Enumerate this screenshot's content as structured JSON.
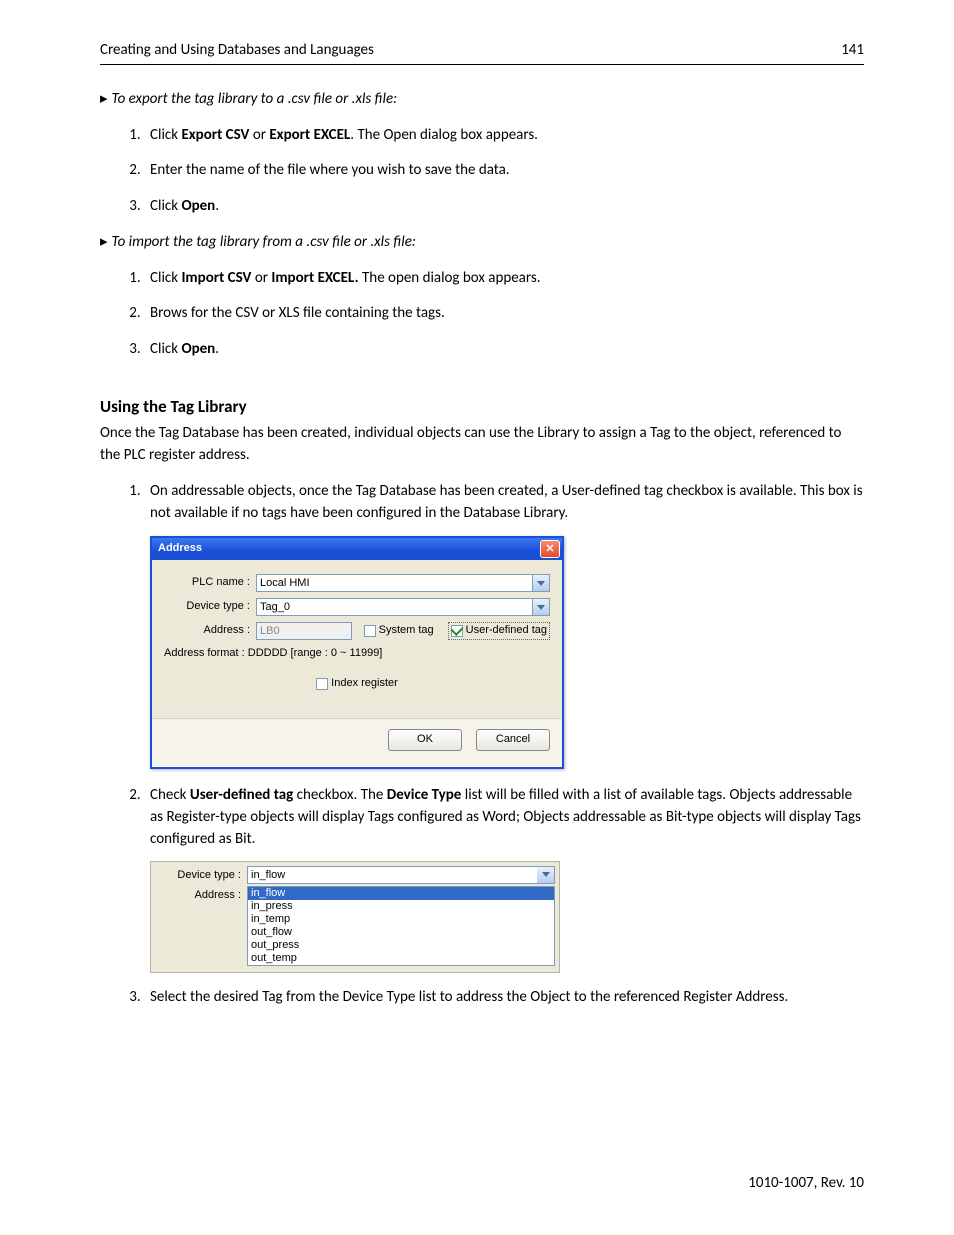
{
  "header": {
    "title": "Creating and Using Databases and Languages",
    "page": "141"
  },
  "export": {
    "prompt": "To export the tag library to a .csv file or .xls file:",
    "steps": {
      "s1_pre": "Click ",
      "s1_b1": "Export CSV",
      "s1_mid": " or ",
      "s1_b2": "Export EXCEL",
      "s1_post": ". The Open dialog box appears.",
      "s2": "Enter the name of the file where you wish to save the data.",
      "s3_pre": "Click ",
      "s3_b": "Open",
      "s3_post": "."
    }
  },
  "import": {
    "prompt": "To import the tag library from a .csv file or .xls file:",
    "steps": {
      "s1_pre": "Click ",
      "s1_b1": "Import CSV",
      "s1_mid": " or ",
      "s1_b2": "Import EXCEL.",
      "s1_post": " The open dialog box appears.",
      "s2": "Brows for the CSV or XLS file containing the tags.",
      "s3_pre": "Click ",
      "s3_b": "Open",
      "s3_post": "."
    }
  },
  "section": {
    "title": "Using the Tag Library",
    "intro": "Once the Tag Database has been created, individual objects can use the Library to assign a Tag to the object, referenced to the PLC register address.",
    "step1": "On addressable objects, once the Tag Database has been created, a User-defined tag checkbox is available. This box is not available if no tags have been configured in the Database Library.",
    "step2_pre": "Check ",
    "step2_b1": "User-defined tag",
    "step2_mid": " checkbox. The ",
    "step2_b2": "Device Type",
    "step2_post": " list will be filled with a list of available tags. Objects addressable as Register-type objects will display Tags configured as Word; Objects addressable as Bit-type objects will display Tags configured as Bit.",
    "step3": "Select the desired Tag from the Device Type list to address the Object to the referenced Register Address."
  },
  "dialog": {
    "title": "Address",
    "plc_label": "PLC name :",
    "plc_value": "Local HMI",
    "dev_label": "Device type :",
    "dev_value": "Tag_0",
    "addr_label": "Address :",
    "addr_value": "LB0",
    "systag": "System tag",
    "usertag": "User-defined tag",
    "format": "Address format : DDDDD [range : 0 ~ 11999]",
    "idx": "Index register",
    "ok": "OK",
    "cancel": "Cancel"
  },
  "mini": {
    "dev_label": "Device type :",
    "dev_value": "in_flow",
    "addr_label": "Address :",
    "opts": [
      "in_flow",
      "in_press",
      "in_temp",
      "out_flow",
      "out_press",
      "out_temp"
    ]
  },
  "footer": "1010-1007, Rev. 10"
}
